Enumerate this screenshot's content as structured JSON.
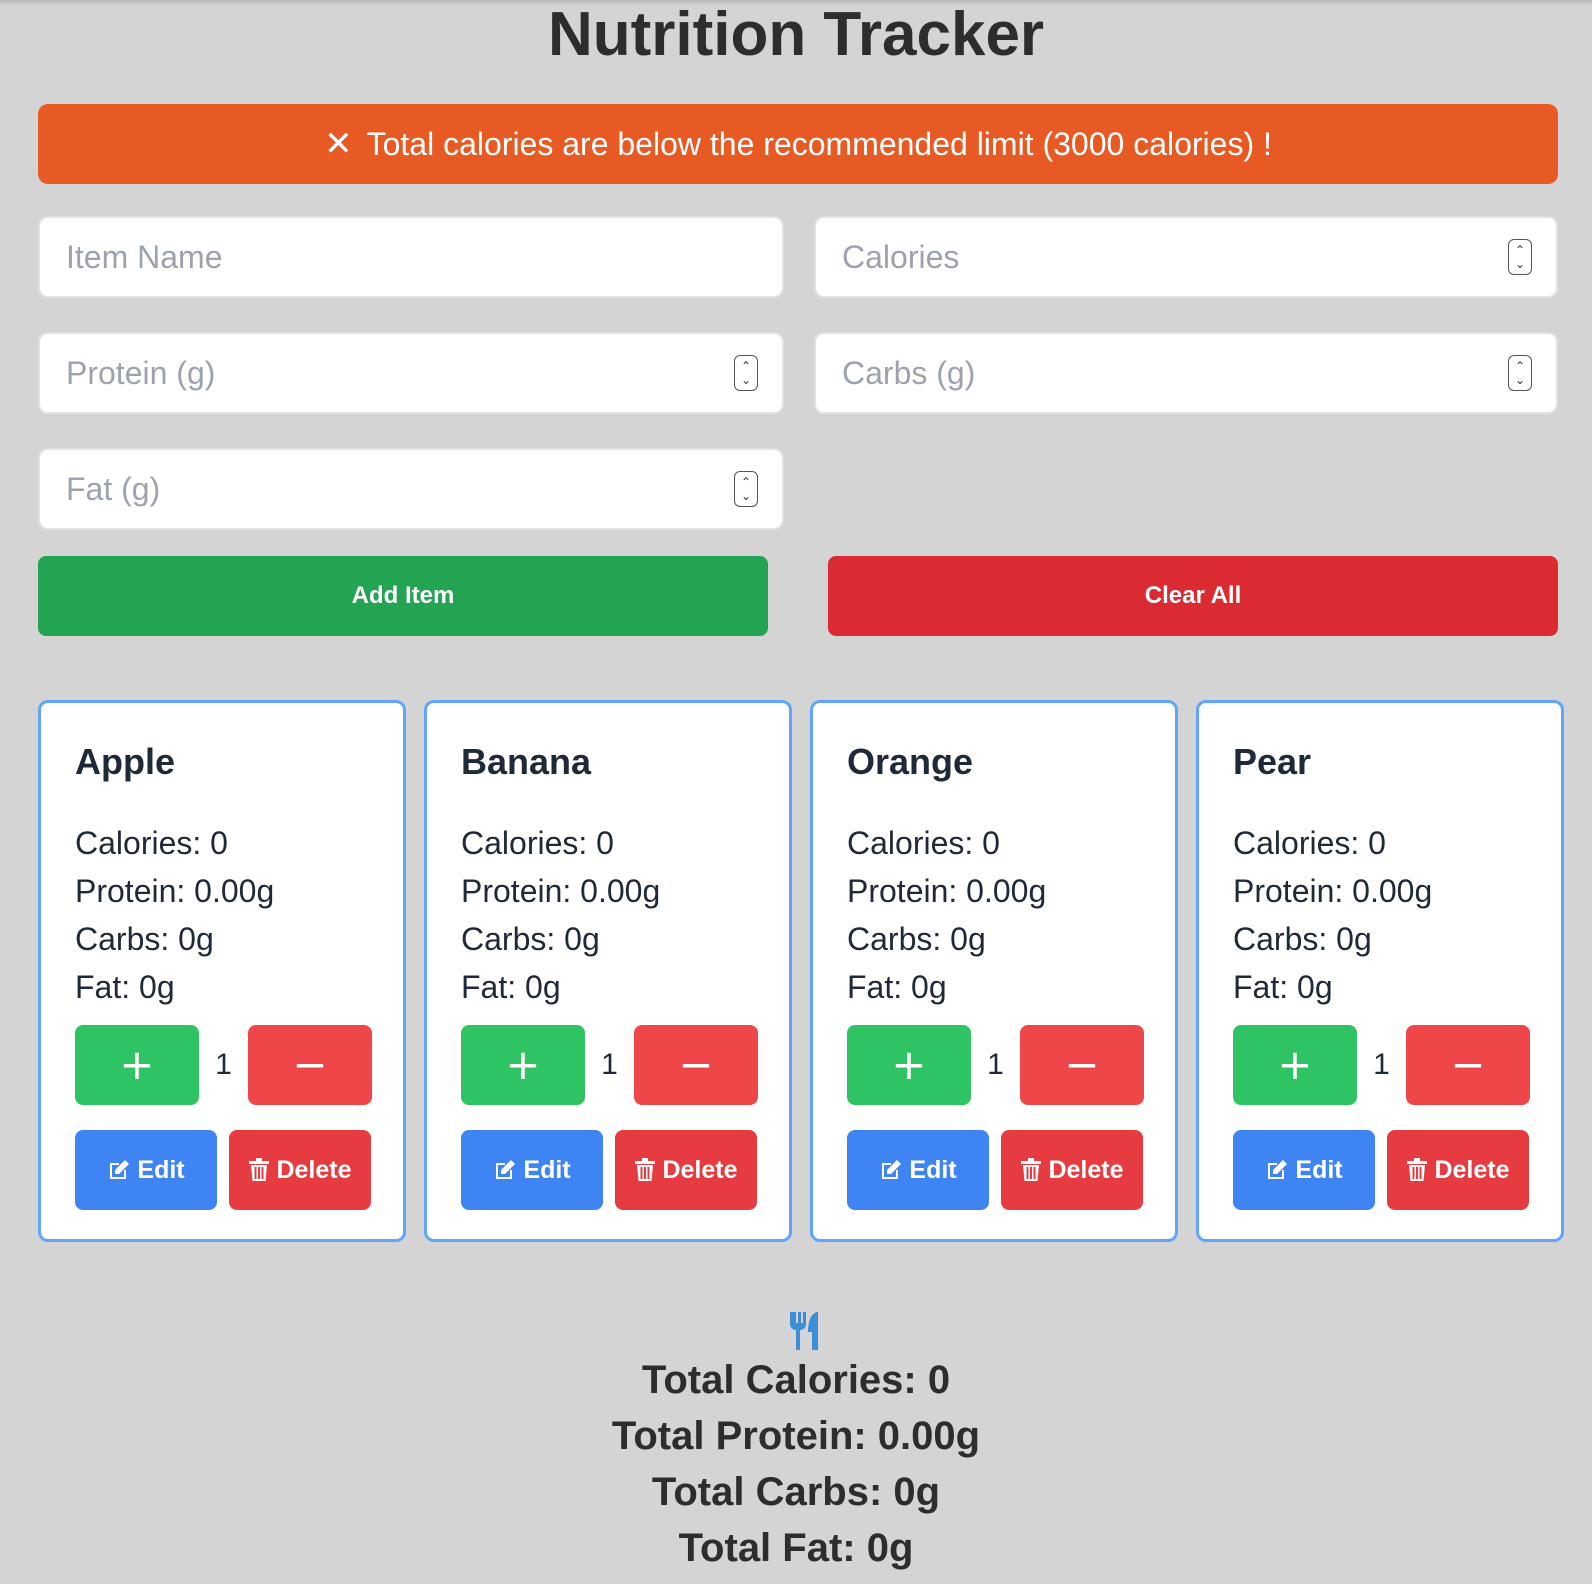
{
  "page": {
    "title": "Nutrition Tracker"
  },
  "alert": {
    "icon": "close-icon",
    "message": "Total calories are below the recommended limit (3000 calories) !",
    "color": "#e85a24"
  },
  "form": {
    "item_name_placeholder": "Item Name",
    "calories_placeholder": "Calories",
    "protein_placeholder": "Protein (g)",
    "carbs_placeholder": "Carbs (g)",
    "fat_placeholder": "Fat (g)",
    "add_label": "Add Item",
    "clear_label": "Clear All"
  },
  "colors": {
    "add": "#23a452",
    "clear": "#db2a32",
    "plus": "#2fc463",
    "minus": "#ef4649",
    "edit": "#3f84f3",
    "delete": "#e63b40",
    "card_border": "#60a5fa"
  },
  "items": [
    {
      "name": "Apple",
      "calories": "Calories: 0",
      "protein": "Protein: 0.00g",
      "carbs": "Carbs: 0g",
      "fat": "Fat: 0g",
      "quantity": "1",
      "plus": "+",
      "minus": "−",
      "edit": "Edit",
      "delete": "Delete"
    },
    {
      "name": "Banana",
      "calories": "Calories: 0",
      "protein": "Protein: 0.00g",
      "carbs": "Carbs: 0g",
      "fat": "Fat: 0g",
      "quantity": "1",
      "plus": "+",
      "minus": "−",
      "edit": "Edit",
      "delete": "Delete"
    },
    {
      "name": "Orange",
      "calories": "Calories: 0",
      "protein": "Protein: 0.00g",
      "carbs": "Carbs: 0g",
      "fat": "Fat: 0g",
      "quantity": "1",
      "plus": "+",
      "minus": "−",
      "edit": "Edit",
      "delete": "Delete"
    },
    {
      "name": "Pear",
      "calories": "Calories: 0",
      "protein": "Protein: 0.00g",
      "carbs": "Carbs: 0g",
      "fat": "Fat: 0g",
      "quantity": "1",
      "plus": "+",
      "minus": "−",
      "edit": "Edit",
      "delete": "Delete"
    }
  ],
  "summary": {
    "icon": "utensils-icon",
    "total_calories": "Total Calories: 0",
    "total_protein": "Total Protein: 0.00g",
    "total_carbs": "Total Carbs: 0g",
    "total_fat": "Total Fat: 0g"
  }
}
